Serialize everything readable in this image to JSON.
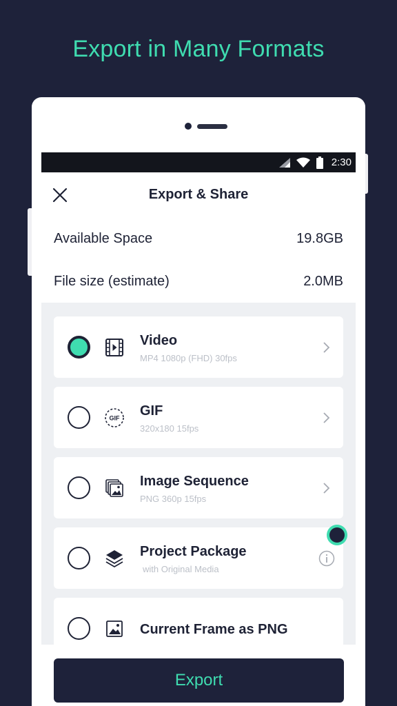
{
  "headline": "Export in Many Formats",
  "status_bar": {
    "time": "2:30"
  },
  "header": {
    "title": "Export & Share"
  },
  "info": [
    {
      "label": "Available Space",
      "value": "19.8GB"
    },
    {
      "label": "File size (estimate)",
      "value": "2.0MB"
    }
  ],
  "options": [
    {
      "title": "Video",
      "subtitle": "MP4 1080p (FHD) 30fps",
      "selected": true,
      "icon": "film-icon"
    },
    {
      "title": "GIF",
      "subtitle": "320x180 15fps",
      "selected": false,
      "icon": "gif-icon",
      "icon_text": "GIF"
    },
    {
      "title": "Image Sequence",
      "subtitle": "PNG 360p 15fps",
      "selected": false,
      "icon": "image-stack-icon"
    },
    {
      "title": "Project Package",
      "subtitle": "with Original Media",
      "selected": false,
      "icon": "layers-icon"
    },
    {
      "title": "Current Frame as PNG",
      "subtitle": "",
      "selected": false,
      "icon": "image-icon"
    }
  ],
  "footer": {
    "export_label": "Export"
  },
  "colors": {
    "accent": "#3fdcb0",
    "dark": "#1e223a",
    "text": "#1e2235",
    "muted": "#bcc0c8"
  }
}
